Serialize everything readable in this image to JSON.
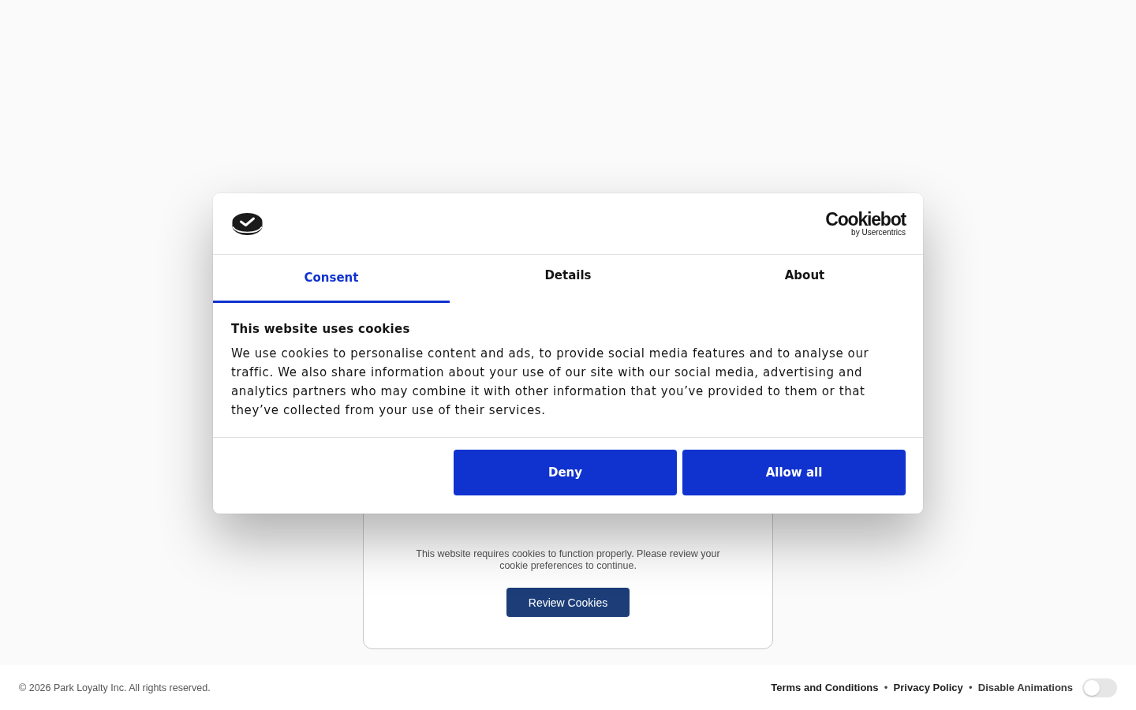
{
  "dialog": {
    "logo": {
      "name": "Cookiebot",
      "byline": "by Usercentrics"
    },
    "tabs": [
      {
        "label": "Consent",
        "selected": true
      },
      {
        "label": "Details",
        "selected": false
      },
      {
        "label": "About",
        "selected": false
      }
    ],
    "title": "This website uses cookies",
    "body": "We use cookies to personalise content and ads, to provide social media features and to analyse our traffic. We also share information about your use of our site with our social media, advertising and analytics partners who may combine it with other information that you’ve provided to them or that they’ve collected from your use of their services.",
    "buttons": [
      {
        "label": "Deny"
      },
      {
        "label": "Allow all"
      }
    ]
  },
  "notice": {
    "message": "This website requires cookies to function properly. Please review your cookie preferences to continue.",
    "button": "Review Cookies"
  },
  "footer": {
    "copyright": "© 2026 Park Loyalty Inc. All rights reserved.",
    "items": [
      {
        "kind": "link",
        "text": "Terms and Conditions"
      },
      {
        "kind": "separator",
        "text": "•"
      },
      {
        "kind": "link",
        "text": "Privacy Policy"
      },
      {
        "kind": "separator",
        "text": "•"
      },
      {
        "kind": "label",
        "text": "Disable Animations"
      }
    ],
    "animations_toggle": {
      "on": false
    }
  }
}
